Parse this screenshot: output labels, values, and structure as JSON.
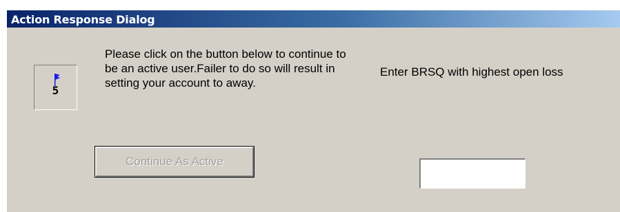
{
  "dialog": {
    "title": "Action Response Dialog",
    "countdown": {
      "value": "5",
      "icon": "flag-icon"
    },
    "message": "Please click on the button below to continue to be an active user.Failer to do so will result in setting your account to away.",
    "prompt": "Enter BRSQ with highest open loss",
    "continue_button_label": "Continue As Active",
    "continue_button_state": "disabled",
    "brsq_input": {
      "value": "",
      "placeholder": ""
    }
  },
  "colors": {
    "titlebar_start": "#0a246a",
    "titlebar_end": "#a6caf0",
    "dialog_face": "#d4d0c8",
    "disabled_text": "#a0a0a0",
    "flag": "#1a1ae8"
  }
}
